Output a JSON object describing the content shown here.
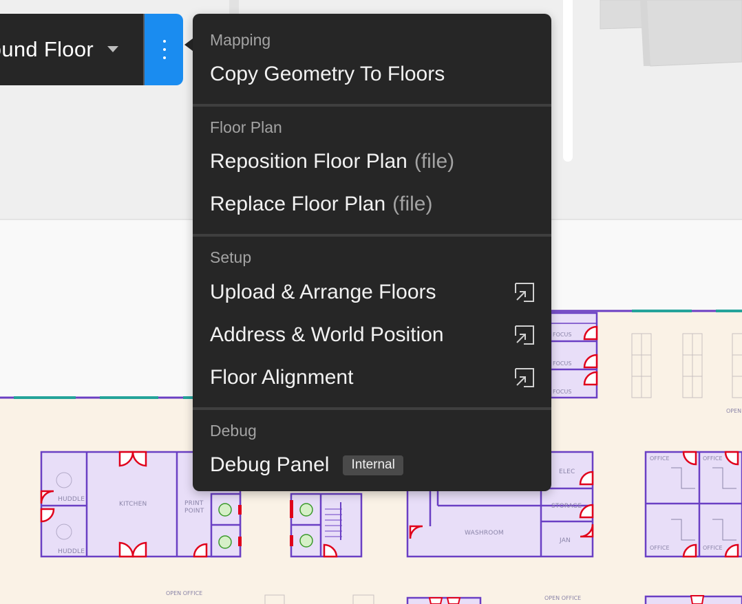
{
  "floor_selector": {
    "current_floor": "Ground Floor"
  },
  "menu": {
    "sections": [
      {
        "title": "Mapping",
        "items": [
          {
            "label": "Copy Geometry To Floors"
          }
        ]
      },
      {
        "title": "Floor Plan",
        "items": [
          {
            "label": "Reposition Floor Plan",
            "suffix": "(file)"
          },
          {
            "label": "Replace Floor Plan",
            "suffix": "(file)"
          }
        ]
      },
      {
        "title": "Setup",
        "items": [
          {
            "label": "Upload & Arrange Floors",
            "icon": "external-link-icon"
          },
          {
            "label": "Address & World Position",
            "icon": "external-link-icon"
          },
          {
            "label": "Floor Alignment",
            "icon": "external-link-icon"
          }
        ]
      },
      {
        "title": "Debug",
        "items": [
          {
            "label": "Debug Panel",
            "badge": "Internal"
          }
        ]
      }
    ]
  },
  "map": {
    "room_labels": {
      "huddle_1": "HUDDLE",
      "huddle_2": "HUDDLE",
      "kitchen": "KITCHEN",
      "print_point_1": "PRINT",
      "print_point_2": "POINT",
      "washroom": "WASHROOM",
      "elec": "ELEC",
      "storage": "STORAGE",
      "jan": "JAN",
      "focus_1": "FOCUS",
      "focus_2": "FOCUS",
      "focus_3": "FOCUS",
      "office_1": "OFFICE",
      "office_2": "OFFICE",
      "office_3": "OFFICE",
      "office_4": "OFFICE",
      "open_office_1": "OPEN OFFICE",
      "open_office_2": "OPEN OFFICE",
      "open_partial": "OPEN"
    }
  },
  "colors": {
    "menu_bg": "#262626",
    "accent": "#1a8cf0",
    "room_fill": "#e8def8",
    "room_stroke": "#6a3fc4",
    "door": "#e0001b",
    "floor_bg": "#faf2e6"
  }
}
